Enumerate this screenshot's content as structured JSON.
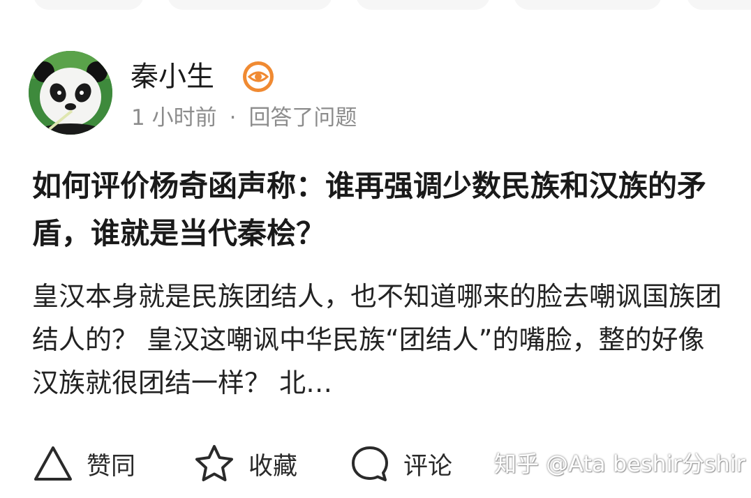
{
  "author": {
    "name": "秦小生",
    "badge_icon": "eye-badge-icon",
    "badge_color": "#f08a32"
  },
  "meta": {
    "time": "1 小时前",
    "separator": "·",
    "action": "回答了问题"
  },
  "question": {
    "title": "如何评价杨奇函声称：谁再强调少数民族和汉族的矛盾，谁就是当代秦桧？"
  },
  "answer": {
    "excerpt": "皇汉本身就是民族团结人，也不知道哪来的脸去嘲讽国族团结人的？ 皇汉这嘲讽中华民族“团结人”的嘴脸，整的好像汉族就很团结一样？ 北…"
  },
  "actions": {
    "like_label": "赞同",
    "like_icon": "triangle-up-icon",
    "favorite_label": "收藏",
    "favorite_icon": "star-icon",
    "comment_label": "评论",
    "comment_icon": "comment-bubble-icon"
  },
  "watermark": "知乎 @Ata beshir分shir"
}
